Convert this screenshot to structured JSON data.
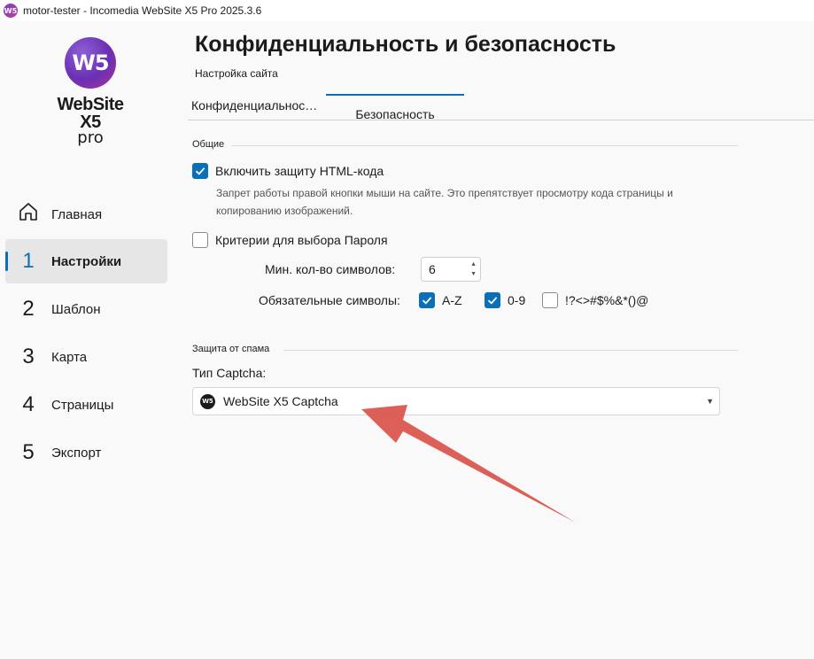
{
  "window": {
    "title": "motor-tester - Incomedia WebSite X5 Pro 2025.3.6",
    "icon_text": "W5"
  },
  "logo": {
    "badge": "W5",
    "name": "WebSite X5",
    "edition": "pro"
  },
  "sidebar": {
    "items": [
      {
        "num": "",
        "label": "Главная",
        "icon": "home-icon"
      },
      {
        "num": "1",
        "label": "Настройки"
      },
      {
        "num": "2",
        "label": "Шаблон"
      },
      {
        "num": "3",
        "label": "Карта"
      },
      {
        "num": "4",
        "label": "Страницы"
      },
      {
        "num": "5",
        "label": "Экспорт"
      }
    ],
    "active_index": 1
  },
  "header": {
    "title": "Конфиденциальность и безопасность",
    "subtitle": "Настройка сайта"
  },
  "tabs": [
    {
      "label": "Конфиденциальнос…"
    },
    {
      "label": "Безопасность"
    }
  ],
  "general": {
    "section": "Общие",
    "protect_html": {
      "label": "Включить защиту HTML-кода",
      "checked": true
    },
    "protect_desc": "Запрет работы правой кнопки мыши на сайте. Это препятствует просмотру кода страницы и копированию изображений.",
    "password_criteria": {
      "label": "Критерии для выбора Пароля",
      "checked": false
    },
    "min_chars_label": "Мин. кол-во символов:",
    "min_chars_value": "6",
    "required_label": "Обязательные символы:",
    "required": [
      {
        "label": "A-Z",
        "checked": true
      },
      {
        "label": "0-9",
        "checked": true
      },
      {
        "label": "!?<>#$%&*()@",
        "checked": false
      }
    ]
  },
  "spam": {
    "section": "Защита от спама",
    "captcha_label": "Тип Captcha:",
    "captcha_value": "WebSite X5 Captcha",
    "captcha_icon_text": "W5"
  },
  "colors": {
    "accent": "#0a6fb8",
    "arrow": "#d9534a"
  }
}
